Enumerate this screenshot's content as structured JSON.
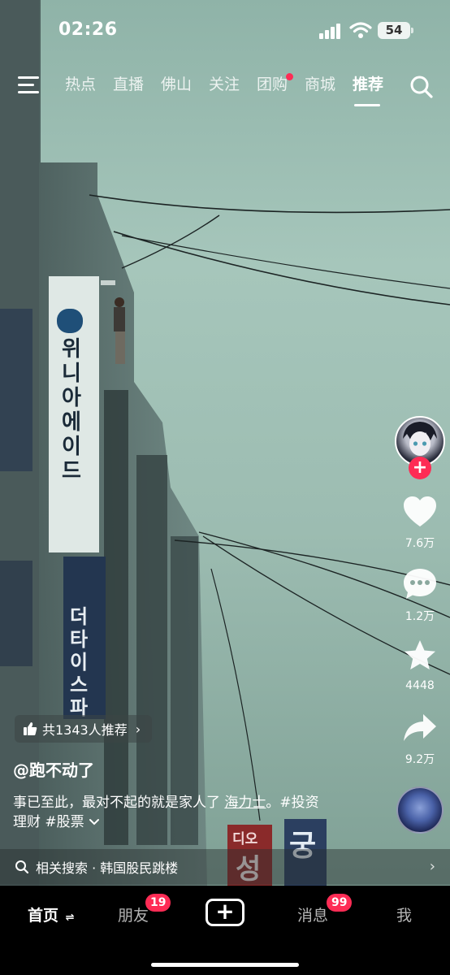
{
  "status_bar": {
    "time": "02:26",
    "battery": "54"
  },
  "top_nav": {
    "tabs": [
      "热点",
      "直播",
      "佛山",
      "关注",
      "团购",
      "商城",
      "推荐"
    ],
    "active_tab": "推荐",
    "dot_tab": "团购"
  },
  "video": {
    "sign_text_1": "위니아에이드",
    "sign_text_2": "더타이스파",
    "sign_text_3": "디오",
    "sign_text_4": "성",
    "sign_text_5": "궁"
  },
  "actions": {
    "likes": "7.6万",
    "comments": "1.2万",
    "favorites": "4448",
    "shares": "9.2万"
  },
  "post": {
    "recommend_text": "共1343人推荐",
    "author": "@跑不动了",
    "description_main": "事已至此，最对不起的就是家人了 ",
    "description_highlight": "海力士",
    "description_tags_1": "。#投资",
    "description_tags_2": "理财 #股票",
    "related_label": "相关搜索 · 韩国股民跳楼"
  },
  "bottom_nav": {
    "home": "首页",
    "friends": "朋友",
    "friends_badge": "19",
    "messages": "消息",
    "messages_badge": "99",
    "me": "我"
  }
}
